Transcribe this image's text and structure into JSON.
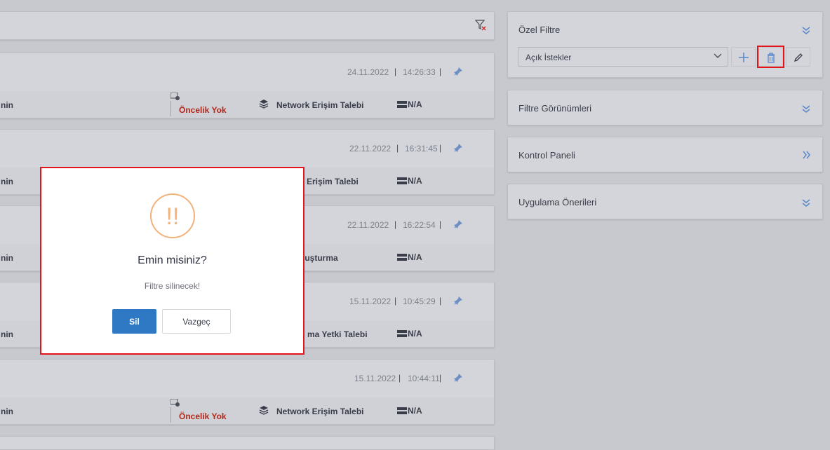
{
  "tickets": [
    {
      "date": "24.11.2022",
      "sep1": "|",
      "time": "14:26:33",
      "sep2": "|",
      "left": "nin",
      "priority": "Öncelik Yok",
      "category": "Network Erişim Talebi",
      "status": "N/A"
    },
    {
      "date": "22.11.2022",
      "sep1": "|",
      "time": "16:31:45",
      "sep2": "|",
      "left": "nin",
      "category": "k Erişim Talebi",
      "status": "N/A"
    },
    {
      "date": "22.11.2022",
      "sep1": "|",
      "time": "16:22:54",
      "sep2": "|",
      "left": "nin",
      "category": "luşturma",
      "status": "N/A"
    },
    {
      "date": "15.11.2022",
      "sep1": "|",
      "time": "10:45:29",
      "sep2": "|",
      "left": "nin",
      "category": "ma Yetki Talebi",
      "status": "N/A"
    },
    {
      "date": "15.11.2022",
      "sep1": "|",
      "time": "10:44:11",
      "sep2": "|",
      "left": "nin",
      "priority": "Öncelik Yok",
      "category": "Network Erişim Talebi",
      "status": "N/A"
    }
  ],
  "right_panel": {
    "ozel_filtre": {
      "title": "Özel Filtre",
      "selected": "Açık İstekler"
    },
    "filtre_gorunumleri": {
      "title": "Filtre Görünümleri"
    },
    "kontrol_paneli": {
      "title": "Kontrol Paneli"
    },
    "uygulama_onerileri": {
      "title": "Uygulama Önerileri"
    }
  },
  "dialog": {
    "icon": "!!",
    "title": "Emin misiniz?",
    "message": "Filtre silinecek!",
    "confirm_label": "Sil",
    "cancel_label": "Vazgeç"
  },
  "colors": {
    "accent": "#2f78c4",
    "priority": "#b0281d",
    "highlight": "#e3141a",
    "warning": "#f2b27c"
  },
  "icons": [
    "filter-clear-icon",
    "pin-icon",
    "priority-icon",
    "stack-icon",
    "server-icon",
    "chevron-double-down-icon",
    "chevron-double-right-icon",
    "plus-icon",
    "trash-icon",
    "pencil-icon",
    "warning-icon"
  ]
}
